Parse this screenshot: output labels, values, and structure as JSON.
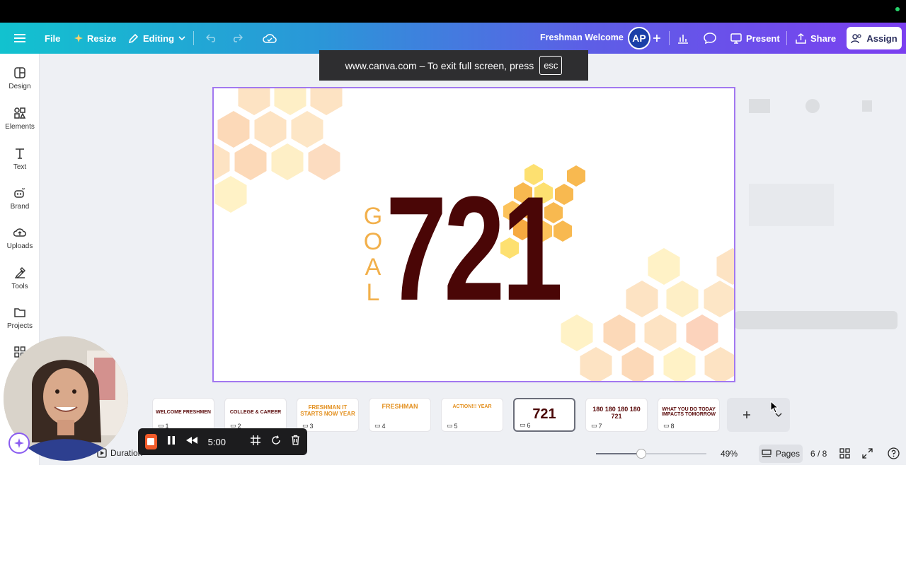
{
  "header": {
    "file_label": "File",
    "resize_label": "Resize",
    "editing_label": "Editing",
    "doc_title": "Freshman Welcome",
    "avatar_initials": "AP",
    "present_label": "Present",
    "share_label": "Share",
    "assign_label": "Assign"
  },
  "toast": {
    "message": "www.canva.com – To exit full screen, press",
    "key": "esc"
  },
  "sidebar": {
    "items": [
      {
        "label": "Design",
        "icon": "design-icon"
      },
      {
        "label": "Elements",
        "icon": "elements-icon"
      },
      {
        "label": "Text",
        "icon": "text-icon"
      },
      {
        "label": "Brand",
        "icon": "brand-icon"
      },
      {
        "label": "Uploads",
        "icon": "uploads-icon"
      },
      {
        "label": "Tools",
        "icon": "tools-icon"
      },
      {
        "label": "Projects",
        "icon": "projects-icon"
      }
    ]
  },
  "canvas": {
    "goal_letters": [
      "G",
      "O",
      "A",
      "L"
    ],
    "big_number": "721"
  },
  "pages": [
    {
      "num": "1",
      "label": "WELCOME FRESHMEN"
    },
    {
      "num": "2",
      "label": "COLLEGE & CAREER"
    },
    {
      "num": "3",
      "label": "FRESHMAN IT STARTS NOW YEAR"
    },
    {
      "num": "4",
      "label": "FRESHMAN"
    },
    {
      "num": "5",
      "label": "ACTION!!! YEAR"
    },
    {
      "num": "6",
      "label": "721"
    },
    {
      "num": "7",
      "label": "180 180 180 180 721"
    },
    {
      "num": "8",
      "label": "WHAT YOU DO TODAY IMPACTS TOMORROW"
    }
  ],
  "footer": {
    "duration_label": "Duration",
    "zoom": "49%",
    "zoom_fraction": 0.41,
    "pages_label": "Pages",
    "page_count": "6 / 8"
  },
  "recorder": {
    "time": "5:00"
  },
  "colors": {
    "accent_purple": "#7b3ff0",
    "number_maroon": "#4a0606",
    "goal_gold": "#f2b04b",
    "record_orange": "#f25b2a"
  }
}
